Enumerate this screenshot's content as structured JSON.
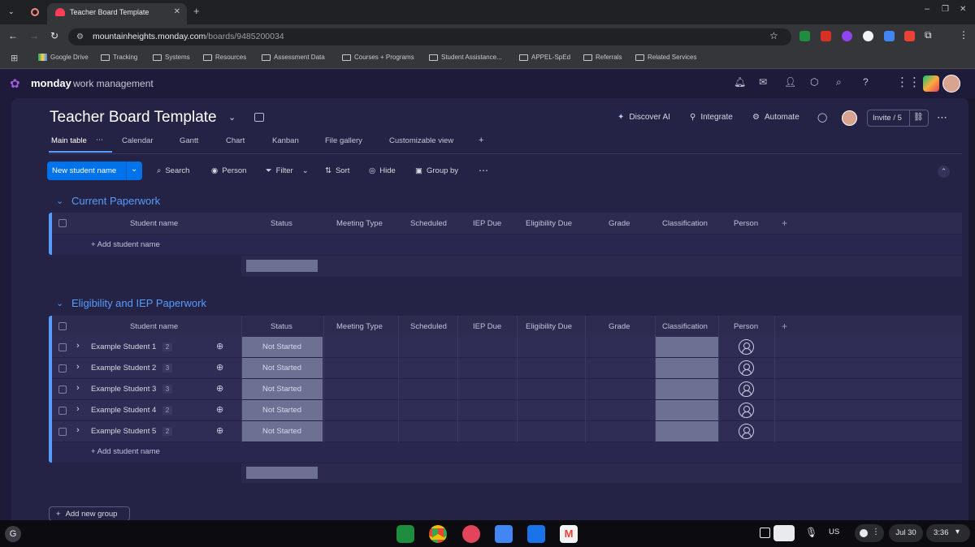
{
  "browser": {
    "tab_title": "Teacher Board Template",
    "url_host": "mountainheights.monday.com",
    "url_path": "/boards/9485200034",
    "bookmarks": [
      "Google Drive",
      "Tracking",
      "Systems",
      "Resources",
      "Assessment Data",
      "Courses + Programs",
      "Student Assistance...",
      "APPEL-SpEd",
      "Referrals",
      "Related Services"
    ]
  },
  "app": {
    "brand": "monday",
    "brand_suffix": "work management"
  },
  "board": {
    "title": "Teacher Board Template",
    "views": [
      "Main table",
      "Calendar",
      "Gantt",
      "Chart",
      "Kanban",
      "File gallery",
      "Customizable view"
    ],
    "discover_ai": "Discover AI",
    "integrate": "Integrate",
    "automate": "Automate",
    "invite": "Invite / 5"
  },
  "toolbar": {
    "new_item": "New student name",
    "search": "Search",
    "person": "Person",
    "filter": "Filter",
    "sort": "Sort",
    "hide": "Hide",
    "group_by": "Group by"
  },
  "columns": [
    "Student name",
    "Status",
    "Meeting Type",
    "Scheduled",
    "IEP Due",
    "Eligibility Due",
    "Grade",
    "Classification",
    "Person"
  ],
  "groups": [
    {
      "title": "Current Paperwork",
      "add_item": "+ Add student name",
      "items": []
    },
    {
      "title": "Eligibility and IEP Paperwork",
      "add_item": "+ Add student name",
      "items": [
        {
          "name": "Example Student 1",
          "count": "2",
          "status": "Not Started"
        },
        {
          "name": "Example Student 2",
          "count": "3",
          "status": "Not Started"
        },
        {
          "name": "Example Student 3",
          "count": "3",
          "status": "Not Started"
        },
        {
          "name": "Example Student 4",
          "count": "2",
          "status": "Not Started"
        },
        {
          "name": "Example Student 5",
          "count": "2",
          "status": "Not Started"
        }
      ]
    }
  ],
  "add_group": "Add new group",
  "taskbar": {
    "locale": "US",
    "date": "Jul 30",
    "time": "3:36"
  },
  "colors": {
    "accent": "#0073ea",
    "group_color": "#579bfc",
    "status_gray": "#6d6f93",
    "board_bg": "#252345"
  }
}
